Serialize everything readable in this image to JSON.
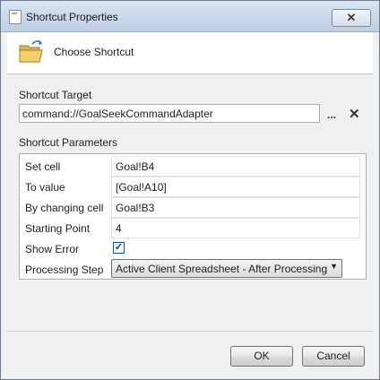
{
  "window": {
    "title": "Shortcut Properties",
    "close_symbol": "✕"
  },
  "header": {
    "text": "Choose Shortcut"
  },
  "target": {
    "label": "Shortcut Target",
    "value": "command://GoalSeekCommandAdapter",
    "browse": "...",
    "clear": "✕"
  },
  "params": {
    "label": "Shortcut Parameters",
    "set_cell": {
      "label": "Set cell",
      "value": "Goal!B4"
    },
    "to_value": {
      "label": "To value",
      "value": "[Goal!A10]"
    },
    "by_changing": {
      "label": "By changing cell",
      "value": "Goal!B3"
    },
    "starting_point": {
      "label": "Starting Point",
      "value": "4"
    },
    "show_error": {
      "label": "Show Error",
      "checked": true,
      "mark": "✓"
    },
    "processing_step": {
      "label": "Processing Step",
      "value": "Active Client Spreadsheet - After Processing",
      "arrow": "▼"
    }
  },
  "buttons": {
    "ok": "OK",
    "cancel": "Cancel"
  },
  "icons": {
    "title": "document-icon",
    "header": "folder-open-icon"
  }
}
